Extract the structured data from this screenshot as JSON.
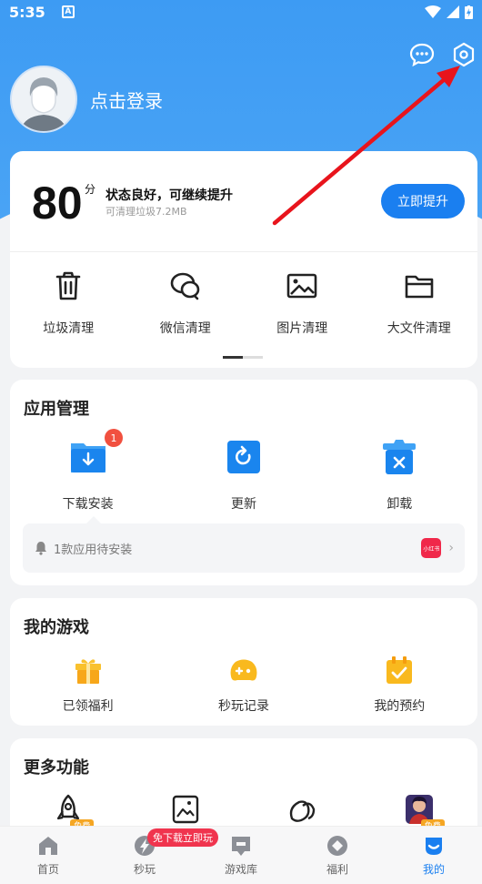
{
  "status_bar": {
    "time": "5:35",
    "notification_icon": "A"
  },
  "header": {
    "login_text": "点击登录",
    "icons": [
      "message-icon",
      "settings-icon"
    ]
  },
  "score_card": {
    "score": "80",
    "unit": "分",
    "title": "状态良好，可继续提升",
    "subtitle": "可清理垃圾7.2MB",
    "boost_label": "立即提升",
    "tools": [
      {
        "label": "垃圾清理",
        "icon": "trash-icon"
      },
      {
        "label": "微信清理",
        "icon": "wechat-icon"
      },
      {
        "label": "图片清理",
        "icon": "image-icon"
      },
      {
        "label": "大文件清理",
        "icon": "folder-icon"
      }
    ]
  },
  "app_management": {
    "title": "应用管理",
    "items": [
      {
        "label": "下载安装",
        "icon": "download-folder-icon",
        "badge": "1"
      },
      {
        "label": "更新",
        "icon": "update-icon"
      },
      {
        "label": "卸载",
        "icon": "uninstall-icon"
      }
    ],
    "pending_text": "1款应用待安装",
    "pending_app_label": "小红书"
  },
  "my_games": {
    "title": "我的游戏",
    "items": [
      {
        "label": "已领福利",
        "icon": "gift-icon"
      },
      {
        "label": "秒玩记录",
        "icon": "gamepad-icon"
      },
      {
        "label": "我的预约",
        "icon": "calendar-check-icon"
      }
    ]
  },
  "more_features": {
    "title": "更多功能",
    "free_tag": "免费",
    "items": [
      {
        "icon": "rocket-icon"
      },
      {
        "icon": "ai-image-icon"
      },
      {
        "icon": "leaf-icon"
      },
      {
        "icon": "game-character-icon"
      }
    ]
  },
  "tab_bar": {
    "promo": "免下载立即玩",
    "tabs": [
      {
        "label": "首页",
        "icon": "home-icon"
      },
      {
        "label": "秒玩",
        "icon": "flash-icon"
      },
      {
        "label": "游戏库",
        "icon": "game-library-icon"
      },
      {
        "label": "福利",
        "icon": "welfare-icon"
      },
      {
        "label": "我的",
        "icon": "profile-icon"
      }
    ],
    "active_index": 4
  },
  "colors": {
    "header_blue": "#3d9bf3",
    "accent": "#1a7ff0",
    "badge_red": "#f1503f",
    "annotation_red": "#e8141c"
  }
}
